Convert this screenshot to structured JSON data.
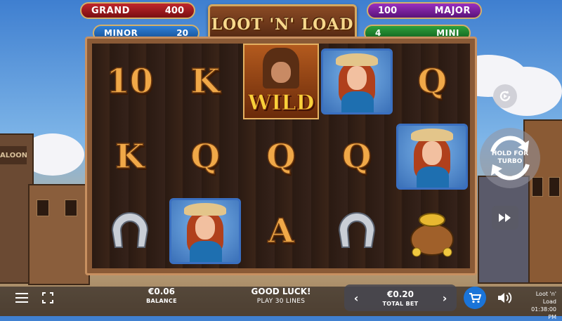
{
  "jackpots": {
    "grand": {
      "name": "GRAND",
      "value": "400"
    },
    "minor": {
      "name": "MINOR",
      "value": "20"
    },
    "major": {
      "name": "MAJOR",
      "value": "100"
    },
    "mini": {
      "name": "MINI",
      "value": "4"
    }
  },
  "logo": "LOOT 'N' LOAD",
  "scenery": {
    "saloon_sign": "ALOON"
  },
  "reels": [
    [
      "10",
      "K",
      "horseshoe"
    ],
    [
      "K",
      "Q",
      "cowgirl"
    ],
    [
      "wild",
      "Q",
      "A"
    ],
    [
      "cowgirl",
      "Q",
      "horseshoe"
    ],
    [
      "Q",
      "cowgirl",
      "gold-bag"
    ]
  ],
  "wild_label": "WILD",
  "controls": {
    "spin_label_1": "HOLD FOR",
    "spin_label_2": "TURBO"
  },
  "bottom_bar": {
    "balance_value": "€0.06",
    "balance_label": "BALANCE",
    "message": "GOOD LUCK!",
    "lines": "PLAY 30 LINES",
    "bet_value": "€0.20",
    "bet_label": "TOTAL BET",
    "bet_decrease": "‹",
    "bet_increase": "›",
    "game_title": "Loot 'n' Load",
    "clock": "01:38:00 PM"
  },
  "colors": {
    "grand": "#c0262b",
    "minor": "#2f80d8",
    "major": "#9a2fc0",
    "mini": "#2ea03c",
    "buy_button": "#1a74d8"
  }
}
